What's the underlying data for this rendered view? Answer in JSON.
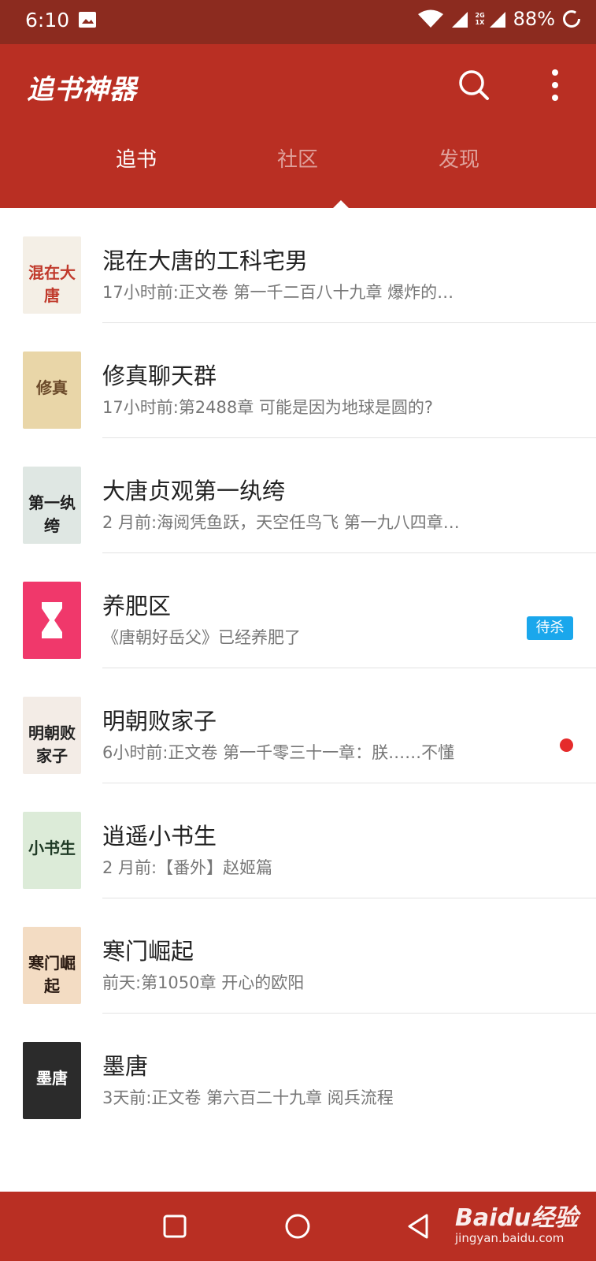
{
  "status_bar": {
    "time": "6:10",
    "network_label": "2G\n1X",
    "battery": "88%"
  },
  "app": {
    "title": "追书神器"
  },
  "tabs": [
    {
      "label": "追书",
      "active": true
    },
    {
      "label": "社区",
      "active": false
    },
    {
      "label": "发现",
      "active": false
    }
  ],
  "books": [
    {
      "title": "混在大唐的工科宅男",
      "subtitle": "17小时前:正文卷 第一千二百八十九章 爆炸的…",
      "cover_text": "混在大唐",
      "cover_colors": [
        "#f4efe6",
        "#c0392b"
      ]
    },
    {
      "title": "修真聊天群",
      "subtitle": "17小时前:第2488章 可能是因为地球是圆的?",
      "cover_text": "修真",
      "cover_colors": [
        "#e9d6a8",
        "#6b4a2a"
      ]
    },
    {
      "title": "大唐贞观第一纨绔",
      "subtitle": "2 月前:海阅凭鱼跃，天空任鸟飞 第一九八四章…",
      "cover_text": "第一纨绔",
      "cover_colors": [
        "#dfe7e3",
        "#1d1d1d"
      ]
    },
    {
      "title": "养肥区",
      "subtitle": "《唐朝好岳父》已经养肥了",
      "cover_text": "",
      "cover_colors": [
        "#f0386b",
        "#ffffff"
      ],
      "badge": "待杀"
    },
    {
      "title": "明朝败家子",
      "subtitle": "6小时前:正文卷 第一千零三十一章：朕……不懂",
      "cover_text": "明朝败家子",
      "cover_colors": [
        "#f3ece6",
        "#222222"
      ],
      "unread": true
    },
    {
      "title": "逍遥小书生",
      "subtitle": "2 月前:【番外】赵姬篇",
      "cover_text": "小书生",
      "cover_colors": [
        "#dcebd8",
        "#1f3a25"
      ]
    },
    {
      "title": "寒门崛起",
      "subtitle": "前天:第1050章 开心的欧阳",
      "cover_text": "寒门崛起",
      "cover_colors": [
        "#f3dcc3",
        "#2a1a12"
      ]
    },
    {
      "title": "墨唐",
      "subtitle": "3天前:正文卷 第六百二十九章 阅兵流程",
      "cover_text": "墨唐",
      "cover_colors": [
        "#2b2b2b",
        "#ffffff"
      ]
    }
  ],
  "nav_bar": {
    "buttons": [
      "square-icon",
      "circle-icon",
      "triangle-back-icon"
    ]
  },
  "watermark": {
    "main": "Baidu经验",
    "sub": "jingyan.baidu.com"
  },
  "colors": {
    "primary": "#b92f23",
    "status": "#8c2b1f",
    "badge": "#1aa7ec",
    "dot": "#e52b2b"
  }
}
